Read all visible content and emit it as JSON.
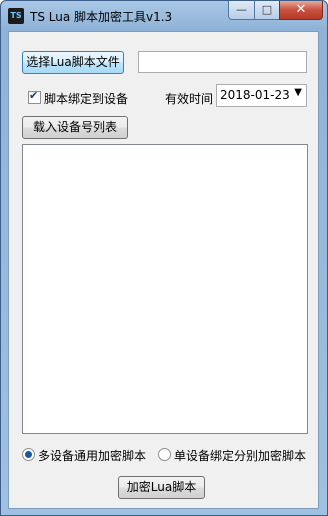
{
  "window": {
    "title": "TS Lua 脚本加密工具v1.3",
    "icon_label": "TS",
    "controls": {
      "minimize": "—",
      "maximize": "□",
      "close": "✕"
    }
  },
  "form": {
    "select_file_button": "选择Lua脚本文件",
    "file_path_value": "",
    "bind_device_checkbox": {
      "label": "脚本绑定到设备",
      "checked": true
    },
    "expiry_label": "有效时间",
    "expiry_date": "2018-01-23",
    "load_device_list_button": "载入设备号列表",
    "device_list_items": [],
    "mode_options": [
      {
        "label": "多设备通用加密脚本",
        "selected": true
      },
      {
        "label": "单设备绑定分别加密脚本",
        "selected": false
      }
    ],
    "encrypt_button": "加密Lua脚本"
  },
  "colors": {
    "accent": "#3c7fb1",
    "frame": "#a9c7e6"
  }
}
